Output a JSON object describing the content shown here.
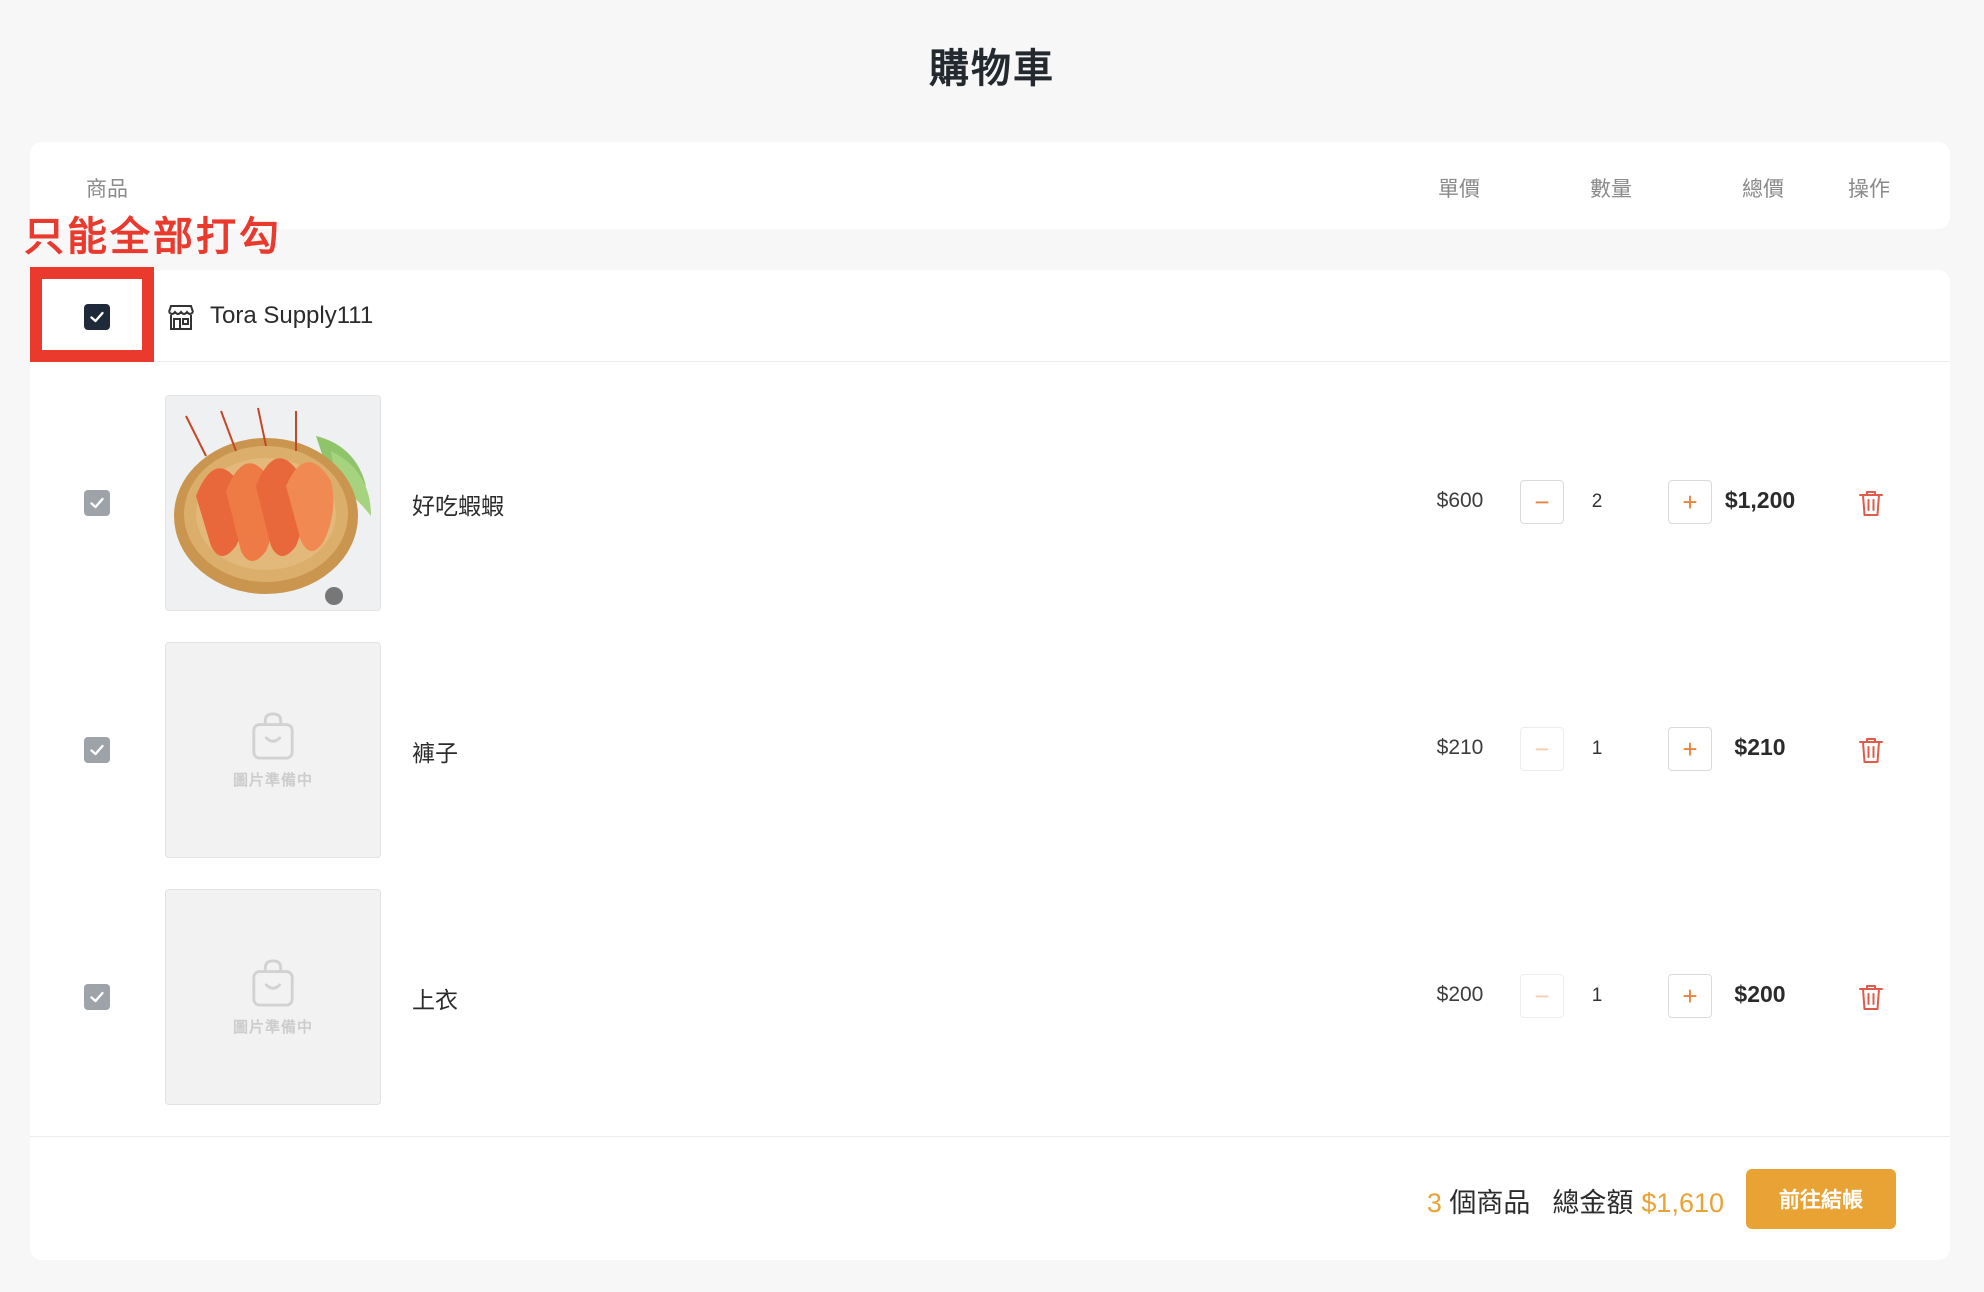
{
  "page": {
    "title": "購物車"
  },
  "header": {
    "col_product": "商品",
    "col_unit_price": "單價",
    "col_quantity": "數量",
    "col_total": "總價",
    "col_action": "操作"
  },
  "annotation": {
    "text": "只能全部打勾",
    "color": "#ea3a2d"
  },
  "store": {
    "name": "Tora Supply111",
    "checked": true,
    "icon": "store-icon"
  },
  "items": [
    {
      "name": "好吃蝦蝦",
      "unit_price": "$600",
      "quantity": "2",
      "total": "$1,200",
      "checked": true,
      "image": "shrimp-photo",
      "minus_enabled": true
    },
    {
      "name": "褲子",
      "unit_price": "$210",
      "quantity": "1",
      "total": "$210",
      "checked": true,
      "image": "placeholder",
      "placeholder_text": "圖片準備中",
      "minus_enabled": false
    },
    {
      "name": "上衣",
      "unit_price": "$200",
      "quantity": "1",
      "total": "$200",
      "checked": true,
      "image": "placeholder",
      "placeholder_text": "圖片準備中",
      "minus_enabled": false
    }
  ],
  "controls": {
    "minus": "−",
    "plus": "+"
  },
  "summary": {
    "count": "3",
    "count_label": " 個商品",
    "total_label": "總金額",
    "total_value": "$1,610",
    "checkout_label": "前往結帳"
  },
  "colors": {
    "accent": "#e8a334",
    "dark": "#1e2a3a",
    "danger": "#e15b4a"
  }
}
